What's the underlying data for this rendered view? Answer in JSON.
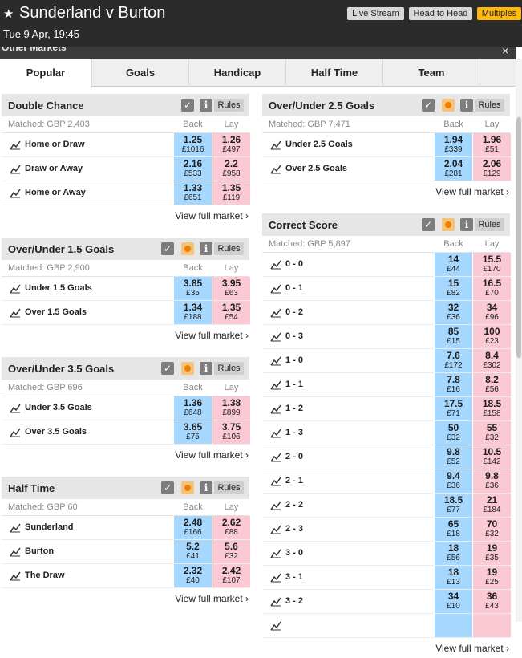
{
  "header": {
    "title": "Sunderland v Burton",
    "datetime": "Tue 9 Apr, 19:45",
    "buttons": {
      "live_stream": "Live Stream",
      "head_to_head": "Head to Head",
      "multiples": "Multiples"
    }
  },
  "other_markets": {
    "label": "Other Markets",
    "close": "×"
  },
  "tabs": [
    "Popular",
    "Goals",
    "Handicap",
    "Half Time",
    "Team"
  ],
  "common": {
    "rules": "Rules",
    "back": "Back",
    "lay": "Lay",
    "view_full": "View full market ›",
    "info": "i",
    "check": "✓"
  },
  "markets": {
    "double_chance": {
      "title": "Double Chance",
      "matched": "Matched: GBP 2,403",
      "rows": [
        {
          "name": "Home or Draw",
          "back": "1.25",
          "back_stake": "£1016",
          "lay": "1.26",
          "lay_stake": "£497"
        },
        {
          "name": "Draw or Away",
          "back": "2.16",
          "back_stake": "£533",
          "lay": "2.2",
          "lay_stake": "£958"
        },
        {
          "name": "Home or Away",
          "back": "1.33",
          "back_stake": "£651",
          "lay": "1.35",
          "lay_stake": "£119"
        }
      ]
    },
    "ou15": {
      "title": "Over/Under 1.5 Goals",
      "matched": "Matched: GBP 2,900",
      "rows": [
        {
          "name": "Under 1.5 Goals",
          "back": "3.85",
          "back_stake": "£35",
          "lay": "3.95",
          "lay_stake": "£63"
        },
        {
          "name": "Over 1.5 Goals",
          "back": "1.34",
          "back_stake": "£188",
          "lay": "1.35",
          "lay_stake": "£54"
        }
      ]
    },
    "ou35": {
      "title": "Over/Under 3.5 Goals",
      "matched": "Matched: GBP 696",
      "rows": [
        {
          "name": "Under 3.5 Goals",
          "back": "1.36",
          "back_stake": "£648",
          "lay": "1.38",
          "lay_stake": "£899"
        },
        {
          "name": "Over 3.5 Goals",
          "back": "3.65",
          "back_stake": "£75",
          "lay": "3.75",
          "lay_stake": "£106"
        }
      ]
    },
    "half_time": {
      "title": "Half Time",
      "matched": "Matched: GBP 60",
      "rows": [
        {
          "name": "Sunderland",
          "back": "2.48",
          "back_stake": "£166",
          "lay": "2.62",
          "lay_stake": "£88"
        },
        {
          "name": "Burton",
          "back": "5.2",
          "back_stake": "£41",
          "lay": "5.6",
          "lay_stake": "£32"
        },
        {
          "name": "The Draw",
          "back": "2.32",
          "back_stake": "£40",
          "lay": "2.42",
          "lay_stake": "£107"
        }
      ]
    },
    "ou25": {
      "title": "Over/Under 2.5 Goals",
      "matched": "Matched: GBP 7,471",
      "rows": [
        {
          "name": "Under 2.5 Goals",
          "back": "1.94",
          "back_stake": "£339",
          "lay": "1.96",
          "lay_stake": "£51"
        },
        {
          "name": "Over 2.5 Goals",
          "back": "2.04",
          "back_stake": "£281",
          "lay": "2.06",
          "lay_stake": "£129"
        }
      ]
    },
    "correct_score": {
      "title": "Correct Score",
      "matched": "Matched: GBP 5,897",
      "rows": [
        {
          "name": "0 - 0",
          "back": "14",
          "back_stake": "£44",
          "lay": "15.5",
          "lay_stake": "£170"
        },
        {
          "name": "0 - 1",
          "back": "15",
          "back_stake": "£82",
          "lay": "16.5",
          "lay_stake": "£70"
        },
        {
          "name": "0 - 2",
          "back": "32",
          "back_stake": "£36",
          "lay": "34",
          "lay_stake": "£96"
        },
        {
          "name": "0 - 3",
          "back": "85",
          "back_stake": "£15",
          "lay": "100",
          "lay_stake": "£23"
        },
        {
          "name": "1 - 0",
          "back": "7.6",
          "back_stake": "£172",
          "lay": "8.4",
          "lay_stake": "£302"
        },
        {
          "name": "1 - 1",
          "back": "7.8",
          "back_stake": "£16",
          "lay": "8.2",
          "lay_stake": "£56"
        },
        {
          "name": "1 - 2",
          "back": "17.5",
          "back_stake": "£71",
          "lay": "18.5",
          "lay_stake": "£158"
        },
        {
          "name": "1 - 3",
          "back": "50",
          "back_stake": "£32",
          "lay": "55",
          "lay_stake": "£32"
        },
        {
          "name": "2 - 0",
          "back": "9.8",
          "back_stake": "£52",
          "lay": "10.5",
          "lay_stake": "£142"
        },
        {
          "name": "2 - 1",
          "back": "9.4",
          "back_stake": "£36",
          "lay": "9.8",
          "lay_stake": "£36"
        },
        {
          "name": "2 - 2",
          "back": "18.5",
          "back_stake": "£77",
          "lay": "21",
          "lay_stake": "£184"
        },
        {
          "name": "2 - 3",
          "back": "65",
          "back_stake": "£18",
          "lay": "70",
          "lay_stake": "£32"
        },
        {
          "name": "3 - 0",
          "back": "18",
          "back_stake": "£56",
          "lay": "19",
          "lay_stake": "£35"
        },
        {
          "name": "3 - 1",
          "back": "18",
          "back_stake": "£13",
          "lay": "19",
          "lay_stake": "£25"
        },
        {
          "name": "3 - 2",
          "back": "34",
          "back_stake": "£10",
          "lay": "36",
          "lay_stake": "£43"
        },
        {
          "name": "",
          "back": "",
          "back_stake": "",
          "lay": "",
          "lay_stake": ""
        }
      ]
    }
  }
}
